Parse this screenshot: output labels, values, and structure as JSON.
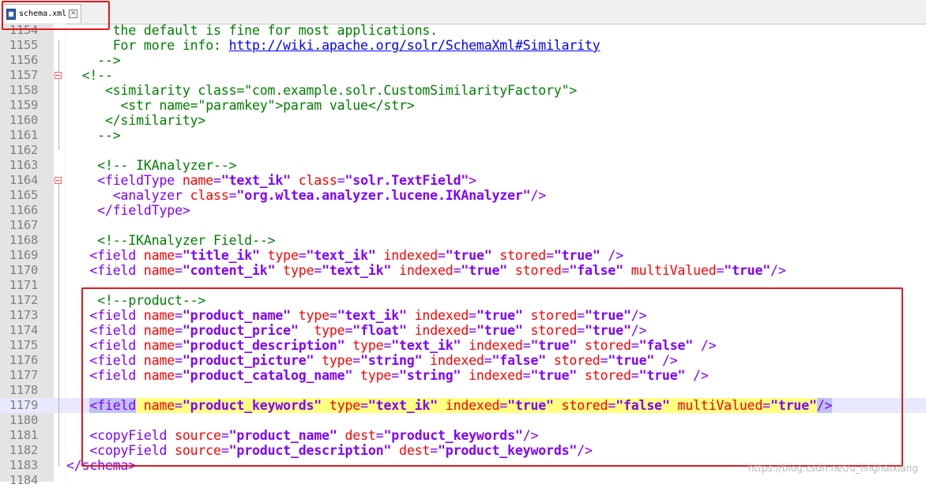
{
  "tab": {
    "filename": "schema.xml",
    "close_icon": "×"
  },
  "watermark": "https://blog.csdn.net/u_linghaixiang",
  "lines": [
    {
      "n": "1154",
      "html": "<span class='cmt'>      the default is fine for most applications.</span>"
    },
    {
      "n": "1155",
      "html": "<span class='cmt'>      For more info: </span><span class='url'>http://wiki.apache.org/solr/SchemaXml#Similarity</span>"
    },
    {
      "n": "1156",
      "html": "<span class='cmt'>    --&gt;</span>"
    },
    {
      "n": "1157",
      "html": "<span class='cmt'>  &lt;!--</span>"
    },
    {
      "n": "1158",
      "html": "<span class='cmt'>     &lt;similarity class=&quot;com.example.solr.CustomSimilarityFactory&quot;&gt;</span>"
    },
    {
      "n": "1159",
      "html": "<span class='cmt'>       &lt;str name=&quot;paramkey&quot;&gt;param value&lt;/str&gt;</span>"
    },
    {
      "n": "1160",
      "html": "<span class='cmt'>     &lt;/similarity&gt;</span>"
    },
    {
      "n": "1161",
      "html": "<span class='cmt'>    --&gt;</span>"
    },
    {
      "n": "1162",
      "html": ""
    },
    {
      "n": "1163",
      "html": "<span class='cmt'>    &lt;!-- IKAnalyzer--&gt;</span>"
    },
    {
      "n": "1164",
      "html": "<span class='tag'>    &lt;fieldType </span><span class='attr'>name</span><span class='tag'>=</span><span class='val'>&quot;text_ik&quot;</span><span class='attr'> class</span><span class='tag'>=</span><span class='val'>&quot;solr.TextField&quot;</span><span class='tag'>&gt;</span>"
    },
    {
      "n": "1165",
      "html": "<span class='tag'>      &lt;analyzer </span><span class='attr'>class</span><span class='tag'>=</span><span class='val'>&quot;org.wltea.analyzer.lucene.IKAnalyzer&quot;</span><span class='tag'>/&gt;</span>"
    },
    {
      "n": "1166",
      "html": "<span class='tag'>    &lt;/fieldType&gt;</span>"
    },
    {
      "n": "1167",
      "html": ""
    },
    {
      "n": "1168",
      "html": "<span class='cmt'>    &lt;!--IKAnalyzer Field--&gt;</span>"
    },
    {
      "n": "1169",
      "html": "<span class='tag'>   &lt;field </span><span class='attr'>name</span><span class='tag'>=</span><span class='val'>&quot;title_ik&quot;</span><span class='attr'> type</span><span class='tag'>=</span><span class='val'>&quot;text_ik&quot;</span><span class='attr'> indexed</span><span class='tag'>=</span><span class='val'>&quot;true&quot;</span><span class='attr'> stored</span><span class='tag'>=</span><span class='val'>&quot;true&quot;</span><span class='tag'> /&gt;</span>"
    },
    {
      "n": "1170",
      "html": "<span class='tag'>   &lt;field </span><span class='attr'>name</span><span class='tag'>=</span><span class='val'>&quot;content_ik&quot;</span><span class='attr'> type</span><span class='tag'>=</span><span class='val'>&quot;text_ik&quot;</span><span class='attr'> indexed</span><span class='tag'>=</span><span class='val'>&quot;true&quot;</span><span class='attr'> stored</span><span class='tag'>=</span><span class='val'>&quot;false&quot;</span><span class='attr'> multiValued</span><span class='tag'>=</span><span class='val'>&quot;true&quot;</span><span class='tag'>/&gt;</span>"
    },
    {
      "n": "1171",
      "html": ""
    },
    {
      "n": "1172",
      "html": "<span class='cmt'>    &lt;!--product--&gt;</span>"
    },
    {
      "n": "1173",
      "html": "<span class='tag'>   &lt;field </span><span class='attr'>name</span><span class='tag'>=</span><span class='val'>&quot;product_name&quot;</span><span class='attr'> type</span><span class='tag'>=</span><span class='val'>&quot;text_ik&quot;</span><span class='attr'> indexed</span><span class='tag'>=</span><span class='val'>&quot;true&quot;</span><span class='attr'> stored</span><span class='tag'>=</span><span class='val'>&quot;true&quot;</span><span class='tag'>/&gt;</span>"
    },
    {
      "n": "1174",
      "html": "<span class='tag'>   &lt;field </span><span class='attr'>name</span><span class='tag'>=</span><span class='val'>&quot;product_price&quot;</span><span class='attr'>  type</span><span class='tag'>=</span><span class='val'>&quot;float&quot;</span><span class='attr'> indexed</span><span class='tag'>=</span><span class='val'>&quot;true&quot;</span><span class='attr'> stored</span><span class='tag'>=</span><span class='val'>&quot;true&quot;</span><span class='tag'>/&gt;</span>"
    },
    {
      "n": "1175",
      "html": "<span class='tag'>   &lt;field </span><span class='attr'>name</span><span class='tag'>=</span><span class='val'>&quot;product_description&quot;</span><span class='attr'> type</span><span class='tag'>=</span><span class='val'>&quot;text_ik&quot;</span><span class='attr'> indexed</span><span class='tag'>=</span><span class='val'>&quot;true&quot;</span><span class='attr'> stored</span><span class='tag'>=</span><span class='val'>&quot;false&quot;</span><span class='tag'> /&gt;</span>"
    },
    {
      "n": "1176",
      "html": "<span class='tag'>   &lt;field </span><span class='attr'>name</span><span class='tag'>=</span><span class='val'>&quot;product_picture&quot;</span><span class='attr'> type</span><span class='tag'>=</span><span class='val'>&quot;string&quot;</span><span class='attr'> indexed</span><span class='tag'>=</span><span class='val'>&quot;false&quot;</span><span class='attr'> stored</span><span class='tag'>=</span><span class='val'>&quot;true&quot;</span><span class='tag'> /&gt;</span>"
    },
    {
      "n": "1177",
      "html": "<span class='tag'>   &lt;field </span><span class='attr'>name</span><span class='tag'>=</span><span class='val'>&quot;product_catalog_name&quot;</span><span class='attr'> type</span><span class='tag'>=</span><span class='val'>&quot;string&quot;</span><span class='attr'> indexed</span><span class='tag'>=</span><span class='val'>&quot;true&quot;</span><span class='attr'> stored</span><span class='tag'>=</span><span class='val'>&quot;true&quot;</span><span class='tag'> /&gt;</span>"
    },
    {
      "n": "1178",
      "html": ""
    },
    {
      "n": "1179",
      "html": "   <span class='tag sel'>&lt;field</span><span class='attr mark'> name</span><span class='tag mark'>=</span><span class='val mark'>&quot;product_keywords&quot;</span><span class='attr mark'> type</span><span class='tag mark'>=</span><span class='val mark'>&quot;text_ik&quot;</span><span class='attr mark'> indexed</span><span class='tag mark'>=</span><span class='val mark'>&quot;true&quot;</span><span class='attr mark'> stored</span><span class='tag mark'>=</span><span class='val mark'>&quot;false&quot;</span><span class='attr mark'> multiValued</span><span class='tag mark'>=</span><span class='val mark'>&quot;true&quot;</span><span class='tag sel'>/&gt;</span>",
      "highlight": true
    },
    {
      "n": "1180",
      "html": ""
    },
    {
      "n": "1181",
      "html": "<span class='tag'>   &lt;copyField </span><span class='attr'>source</span><span class='tag'>=</span><span class='val'>&quot;product_name&quot;</span><span class='attr'> dest</span><span class='tag'>=</span><span class='val'>&quot;product_keywords&quot;</span><span class='tag'>/&gt;</span>"
    },
    {
      "n": "1182",
      "html": "<span class='tag'>   &lt;copyField </span><span class='attr'>source</span><span class='tag'>=</span><span class='val'>&quot;product_description&quot;</span><span class='attr'> dest</span><span class='tag'>=</span><span class='val'>&quot;product_keywords&quot;</span><span class='tag'>/&gt;</span>"
    },
    {
      "n": "1183",
      "html": "<span class='tag'>&lt;/schema&gt;</span>"
    },
    {
      "n": "1184",
      "html": ""
    }
  ],
  "colors": {
    "annotation_box": "#e5191d",
    "tag": "#8000ff",
    "attribute": "#ff0000",
    "comment": "#008000",
    "link": "#0000ff"
  }
}
